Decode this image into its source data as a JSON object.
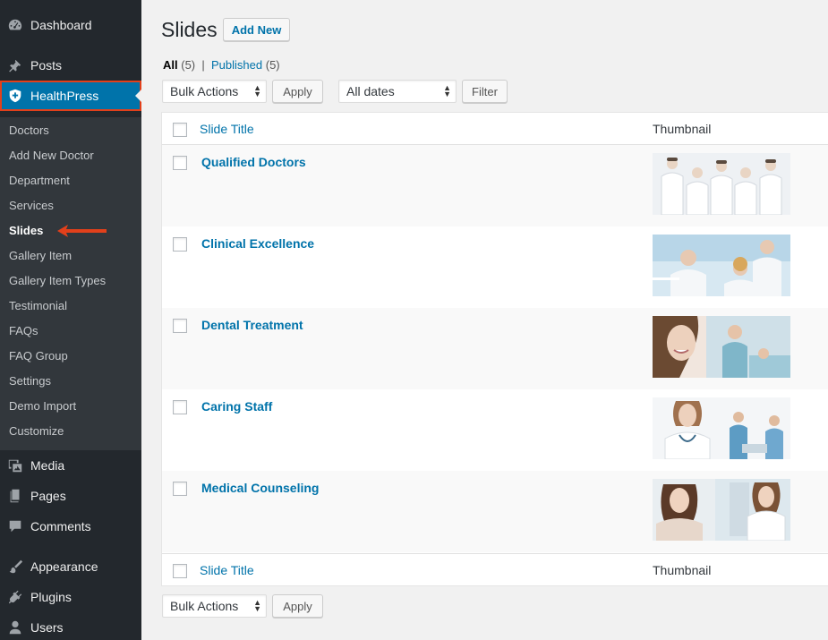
{
  "sidebar": {
    "dashboard": "Dashboard",
    "posts": "Posts",
    "healthpress": "HealthPress",
    "submenu": [
      "Doctors",
      "Add New Doctor",
      "Department",
      "Services",
      "Slides",
      "Gallery Item",
      "Gallery Item Types",
      "Testimonial",
      "FAQs",
      "FAQ Group",
      "Settings",
      "Demo Import",
      "Customize"
    ],
    "media": "Media",
    "pages": "Pages",
    "comments": "Comments",
    "appearance": "Appearance",
    "plugins": "Plugins",
    "users": "Users",
    "icons": {
      "dashboard": "dashboard-gauge-icon",
      "posts": "pushpin-icon",
      "healthpress": "shield-icon",
      "media": "media-camera-icon",
      "pages": "pages-icon",
      "comments": "speech-bubble-icon",
      "appearance": "paintbrush-icon",
      "plugins": "plug-icon",
      "users": "user-icon"
    },
    "active_color": "#0073aa",
    "highlight_color": "#e2401b"
  },
  "header": {
    "title": "Slides",
    "add_new": "Add New"
  },
  "filters": {
    "all_label": "All",
    "all_count": "(5)",
    "separator": "|",
    "published_label": "Published",
    "published_count": "(5)"
  },
  "bulk": {
    "top_select": "Bulk Actions",
    "apply": "Apply",
    "dates_select": "All dates",
    "filter": "Filter",
    "bottom_select": "Bulk Actions",
    "bottom_apply": "Apply"
  },
  "table": {
    "col_title": "Slide Title",
    "col_thumbnail": "Thumbnail",
    "rows": [
      {
        "title": "Qualified Doctors",
        "thumb": "group-of-doctors-photo"
      },
      {
        "title": "Clinical Excellence",
        "thumb": "lab-scientists-photo"
      },
      {
        "title": "Dental Treatment",
        "thumb": "dental-patient-photo"
      },
      {
        "title": "Caring Staff",
        "thumb": "nurse-staff-photo"
      },
      {
        "title": "Medical Counseling",
        "thumb": "patient-doctor-photo"
      }
    ]
  }
}
